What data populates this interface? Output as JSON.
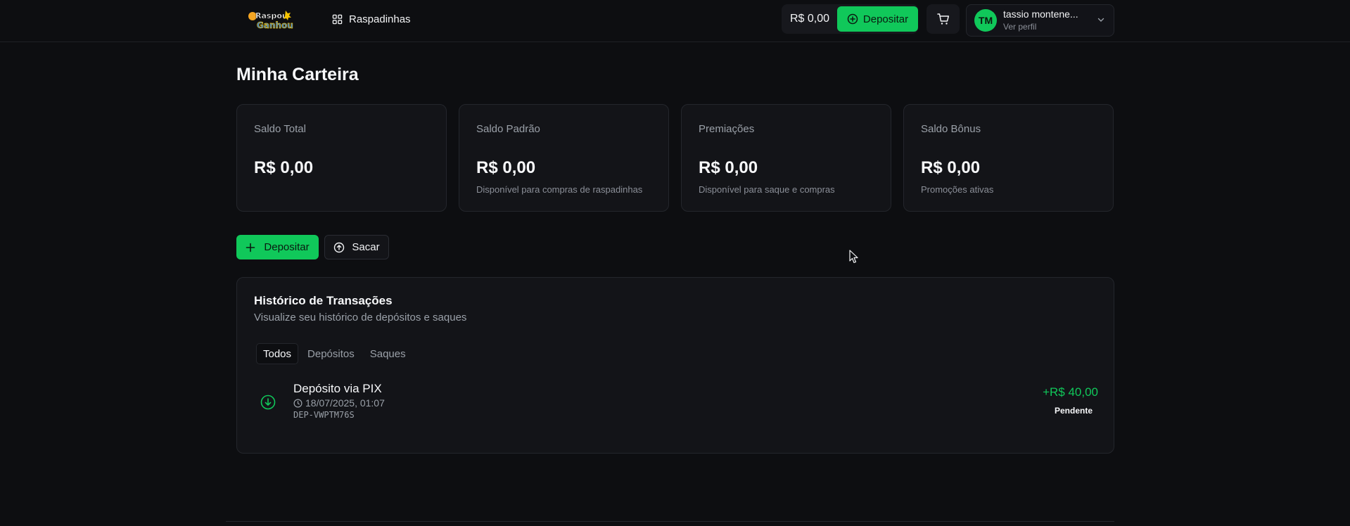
{
  "header": {
    "logo_text": [
      "Raspou",
      "Ganhou"
    ],
    "nav_label": "Raspadinhas",
    "balance": "R$ 0,00",
    "deposit_label": "Depositar",
    "user": {
      "initials": "TM",
      "name": "tassio montene...",
      "subtitle": "Ver perfil"
    }
  },
  "main": {
    "title": "Minha Carteira",
    "cards": [
      {
        "label": "Saldo Total",
        "value": "R$ 0,00",
        "desc": ""
      },
      {
        "label": "Saldo Padrão",
        "value": "R$ 0,00",
        "desc": "Disponível para compras de raspadinhas"
      },
      {
        "label": "Premiações",
        "value": "R$ 0,00",
        "desc": "Disponível para saque e compras"
      },
      {
        "label": "Saldo Bônus",
        "value": "R$ 0,00",
        "desc": "Promoções ativas"
      }
    ],
    "actions": {
      "deposit_label": "Depositar",
      "withdraw_label": "Sacar"
    },
    "history": {
      "title": "Histórico de Transações",
      "subtitle": "Visualize seu histórico de depósitos e saques",
      "tabs": [
        {
          "label": "Todos",
          "active": true
        },
        {
          "label": "Depósitos",
          "active": false
        },
        {
          "label": "Saques",
          "active": false
        }
      ],
      "transactions": [
        {
          "title": "Depósito via PIX",
          "date": "18/07/2025, 01:07",
          "id": "DEP-VWPTM76S",
          "amount": "+R$ 40,00",
          "status": "Pendente"
        }
      ]
    }
  },
  "colors": {
    "background": "#0d0e11",
    "accent": "#10c85a",
    "card": "#131418",
    "muted_text": "#9aa0a8"
  },
  "icons": [
    "grid-icon",
    "plus-circle-icon",
    "cart-icon",
    "chevron-down-icon",
    "plus-icon",
    "arrow-up-circle-icon",
    "arrow-down-circle-icon",
    "clock-icon",
    "cursor-icon"
  ]
}
